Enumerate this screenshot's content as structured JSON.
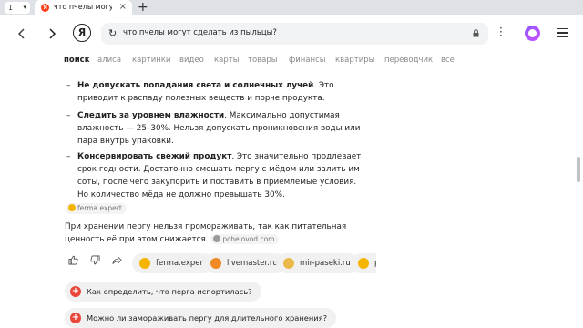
{
  "browser": {
    "tab_count": "1",
    "tab_title": "что пчелы могут сделать из пыльцы?",
    "favicon_letter": "Я",
    "address_text": "что пчелы могут сделать из пыльцы?",
    "logo_letter": "Я"
  },
  "search_tabs": [
    {
      "label": "поиск",
      "active": true
    },
    {
      "label": "алиса"
    },
    {
      "label": "картинки"
    },
    {
      "label": "видео"
    },
    {
      "label": "карты"
    },
    {
      "label": "товары"
    },
    {
      "label": "финансы"
    },
    {
      "label": "квартиры"
    },
    {
      "label": "переводчик"
    },
    {
      "label": "все"
    }
  ],
  "answer": {
    "bullets": [
      {
        "bold": "Не допускать попадания света и солнечных лучей",
        "rest": ". Это приводит к распаду полезных веществ и порче продукта."
      },
      {
        "bold": "Следить за уровнем влажности",
        "rest": ". Максимально допустимая влажность — 25–30%. Нельзя допускать проникновения воды или пара внутрь упаковки."
      },
      {
        "bold": "Консервировать свежий продукт",
        "rest": ". Это значительно продлевает срок годности. Достаточно смешать пергу с мёдом или залить им соты, после чего закупорить и поставить в приемлемые условия. Но количество мёда не должно превышать 30%."
      }
    ],
    "source_1": "ferma.expert",
    "paragraph": "При хранении пергу нельзя промораживать, так как питательная ценность её при этом снижается.",
    "source_2": "pchelovod.com",
    "source_chips": [
      {
        "label": "ferma.expert",
        "color": "#f5b400"
      },
      {
        "label": "livemaster.ru",
        "color": "#f08a24"
      },
      {
        "label": "mir-paseki.ru",
        "color": "#e9b949"
      },
      {
        "label": "pc",
        "color": "#f5b400"
      }
    ]
  },
  "related_questions": [
    "Как определить, что перга испортилась?",
    "Можно ли замораживать пергу для длительного хранения?"
  ]
}
